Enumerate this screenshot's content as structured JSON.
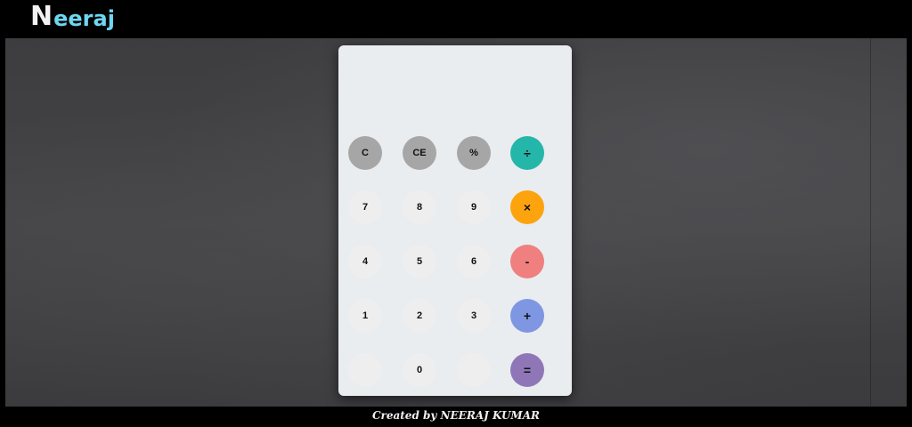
{
  "header": {
    "logo_first": "N",
    "logo_rest": "eeraj",
    "logo_color": "#6fd6f0"
  },
  "calculator": {
    "display_value": "",
    "keys": {
      "clear": "C",
      "clear_entry": "CE",
      "percent": "%",
      "divide": "÷",
      "seven": "7",
      "eight": "8",
      "nine": "9",
      "multiply": "×",
      "four": "4",
      "five": "5",
      "six": "6",
      "subtract": "-",
      "one": "1",
      "two": "2",
      "three": "3",
      "add": "+",
      "blank_left": "",
      "zero": "0",
      "blank_right": "",
      "equals": "="
    },
    "colors": {
      "function_key": "#a7a6a6",
      "digit_key": "#eeeeee",
      "divide": "#25b6aa",
      "multiply": "#fda30e",
      "subtract": "#f07f80",
      "add": "#7f96e2",
      "equals": "#8f77b7"
    }
  },
  "footer": {
    "credit": "Created by NEERAJ KUMAR"
  }
}
